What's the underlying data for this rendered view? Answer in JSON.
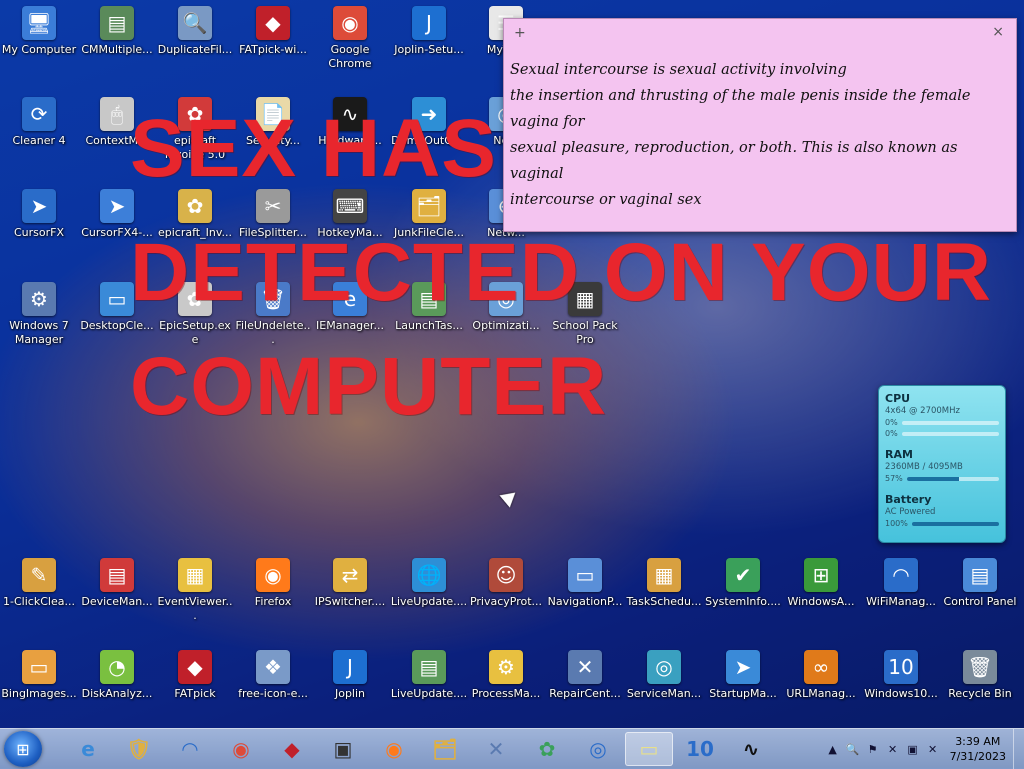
{
  "desktop": {
    "icons": [
      {
        "label": "My Computer",
        "glyph": "🖥",
        "bg": "#3b7dd8"
      },
      {
        "label": "CMMultiple...",
        "glyph": "▤",
        "bg": "#5a8a5a"
      },
      {
        "label": "DuplicateFil...",
        "glyph": "🔍",
        "bg": "#7a99c4"
      },
      {
        "label": "FATpick-wi...",
        "glyph": "◆",
        "bg": "#c0202a"
      },
      {
        "label": "Google Chrome",
        "glyph": "◉",
        "bg": "#dd4b39"
      },
      {
        "label": "Joplin-Setu...",
        "glyph": "J",
        "bg": "#1d6fd1"
      },
      {
        "label": "MyTa...",
        "glyph": "☰",
        "bg": "#e8e8e8"
      },
      {
        "label": "Cleaner 4",
        "glyph": "⟳",
        "bg": "#2a6cc9"
      },
      {
        "label": "ContextM...",
        "glyph": "🖱",
        "bg": "#c8c8c8"
      },
      {
        "label": "epicraft Invoice 5.0",
        "glyph": "✿",
        "bg": "#d23a3a"
      },
      {
        "label": "Security...",
        "glyph": "📄",
        "bg": "#e9d9a8"
      },
      {
        "label": "Hardware...",
        "glyph": "∿",
        "bg": "#1a1a1a"
      },
      {
        "label": "DumpOutQu...",
        "glyph": "➜",
        "bg": "#2d8fd6"
      },
      {
        "label": "Ne...",
        "glyph": "◎",
        "bg": "#6aa0d8"
      },
      {
        "label": "CursorFX",
        "glyph": "➤",
        "bg": "#2a6cc9"
      },
      {
        "label": "CursorFX4-...",
        "glyph": "➤",
        "bg": "#3d7fd9"
      },
      {
        "label": "epicraft_Inv...",
        "glyph": "✿",
        "bg": "#d8b24a"
      },
      {
        "label": "FileSplitter...",
        "glyph": "✂",
        "bg": "#9a9a9a"
      },
      {
        "label": "HotkeyMa...",
        "glyph": "⌨",
        "bg": "#444"
      },
      {
        "label": "JunkFileCle...",
        "glyph": "🗂",
        "bg": "#e0b040"
      },
      {
        "label": "Netw...",
        "glyph": "⊕",
        "bg": "#5a8fd8"
      },
      {
        "label": "Windows 7 Manager",
        "glyph": "⚙",
        "bg": "#5a7ab0"
      },
      {
        "label": "DesktopCle...",
        "glyph": "▭",
        "bg": "#3a8ad8"
      },
      {
        "label": "EpicSetup.exe",
        "glyph": "✿",
        "bg": "#c9c9c9"
      },
      {
        "label": "FileUndelete...",
        "glyph": "🗑",
        "bg": "#4a7ac8"
      },
      {
        "label": "IEManager...",
        "glyph": "e",
        "bg": "#3a7fd8"
      },
      {
        "label": "LaunchTas...",
        "glyph": "▤",
        "bg": "#5a9a5a"
      },
      {
        "label": "Optimizati...",
        "glyph": "◎",
        "bg": "#6aa0d8"
      },
      {
        "label": "School Pack Pro",
        "glyph": "▦",
        "bg": "#3a3a3a"
      },
      {
        "label": "1-ClickClea...",
        "glyph": "✎",
        "bg": "#d8a040"
      },
      {
        "label": "DeviceMan...",
        "glyph": "▤",
        "bg": "#d03a3a"
      },
      {
        "label": "EventViewer...",
        "glyph": "▦",
        "bg": "#e8c040"
      },
      {
        "label": "Firefox",
        "glyph": "◉",
        "bg": "#ff7a1a"
      },
      {
        "label": "IPSwitcher....",
        "glyph": "⇄",
        "bg": "#e0b040"
      },
      {
        "label": "LiveUpdate....",
        "glyph": "🌐",
        "bg": "#2d8fd6"
      },
      {
        "label": "PrivacyProt...",
        "glyph": "☺",
        "bg": "#b04a3a"
      },
      {
        "label": "NavigationP...",
        "glyph": "▭",
        "bg": "#5a8fd8"
      },
      {
        "label": "TaskSchedu...",
        "glyph": "▦",
        "bg": "#d8a040"
      },
      {
        "label": "SystemInfo....",
        "glyph": "✔",
        "bg": "#3aa05a"
      },
      {
        "label": "WindowsA...",
        "glyph": "⊞",
        "bg": "#3a9a3a"
      },
      {
        "label": "WiFiManag...",
        "glyph": "◠",
        "bg": "#2a6cc9"
      },
      {
        "label": "Control Panel",
        "glyph": "▤",
        "bg": "#4a8ad8"
      },
      {
        "label": "BingImages...",
        "glyph": "▭",
        "bg": "#e8a040"
      },
      {
        "label": "DiskAnalyz...",
        "glyph": "◔",
        "bg": "#7ac040"
      },
      {
        "label": "FATpick",
        "glyph": "◆",
        "bg": "#c0202a"
      },
      {
        "label": "free-icon-e...",
        "glyph": "❖",
        "bg": "#7a9ac8"
      },
      {
        "label": "Joplin",
        "glyph": "J",
        "bg": "#1d6fd1"
      },
      {
        "label": "LiveUpdate....",
        "glyph": "▤",
        "bg": "#5a9a5a"
      },
      {
        "label": "ProcessMa...",
        "glyph": "⚙",
        "bg": "#e8c040"
      },
      {
        "label": "RepairCent...",
        "glyph": "✕",
        "bg": "#5a7ab0"
      },
      {
        "label": "ServiceMan...",
        "glyph": "◎",
        "bg": "#3aa0c0"
      },
      {
        "label": "StartupMa...",
        "glyph": "➤",
        "bg": "#3a8ad8"
      },
      {
        "label": "URLManag...",
        "glyph": "∞",
        "bg": "#e07a1a"
      },
      {
        "label": "Windows10...",
        "glyph": "10",
        "bg": "#2a6cc9"
      },
      {
        "label": "Recycle Bin",
        "glyph": "🗑",
        "bg": "#7a8a9a"
      }
    ]
  },
  "overlay": {
    "line1": "SEX HAS B",
    "line2": "DETECTED ON YOUR",
    "line3": "COMPUTER"
  },
  "sticky_note": {
    "add_symbol": "+",
    "close_symbol": "×",
    "lines": [
      "Sexual intercourse is sexual activity involving",
      "the insertion and thrusting of the male penis inside the female vagina for",
      "sexual pleasure, reproduction, or both. This is also known as vaginal",
      "intercourse or vaginal sex"
    ]
  },
  "meter_gadget": {
    "cpu_title": "CPU",
    "cpu_spec": "4x64 @ 2700MHz",
    "cpu_core1": "0%",
    "cpu_core1_value": 0,
    "cpu_core2": "0%",
    "cpu_core2_value": 0,
    "ram_title": "RAM",
    "ram_spec": "2360MB / 4095MB",
    "ram_percent": "57%",
    "ram_value": 57,
    "battery_title": "Battery",
    "battery_status": "AC Powered",
    "battery_percent": "100%",
    "battery_value": 100
  },
  "taskbar": {
    "start_icon": "windows-logo",
    "pinned": [
      {
        "name": "ie-icon",
        "glyph": "e",
        "color": "#3a8ad8"
      },
      {
        "name": "security-icon",
        "glyph": "🛡",
        "color": "#e0b040"
      },
      {
        "name": "wifi-icon",
        "glyph": "◠",
        "color": "#2a6cc9"
      },
      {
        "name": "chrome-icon",
        "glyph": "◉",
        "color": "#dd4b39"
      },
      {
        "name": "fatpick-icon",
        "glyph": "◆",
        "color": "#c0202a"
      },
      {
        "name": "monitor-icon",
        "glyph": "▣",
        "color": "#333"
      },
      {
        "name": "firefox-icon",
        "glyph": "◉",
        "color": "#ff7a1a"
      },
      {
        "name": "explorer-icon",
        "glyph": "🗂",
        "color": "#e0b040"
      },
      {
        "name": "tools-icon",
        "glyph": "✕",
        "color": "#5a7ab0"
      },
      {
        "name": "clover-icon",
        "glyph": "✿",
        "color": "#3aa05a"
      },
      {
        "name": "asa-icon",
        "glyph": "◎",
        "color": "#2a6cc9"
      },
      {
        "name": "notes-icon",
        "glyph": "▭",
        "color": "#e8e08a"
      },
      {
        "name": "windows10-icon",
        "glyph": "10",
        "color": "#2a6cc9"
      },
      {
        "name": "pulse-icon",
        "glyph": "∿",
        "color": "#111"
      }
    ],
    "tray_icons": [
      "▲",
      "🔍",
      "⚑",
      "✕",
      "▣",
      "✕"
    ],
    "time": "3:39 AM",
    "date": "7/31/2023"
  }
}
